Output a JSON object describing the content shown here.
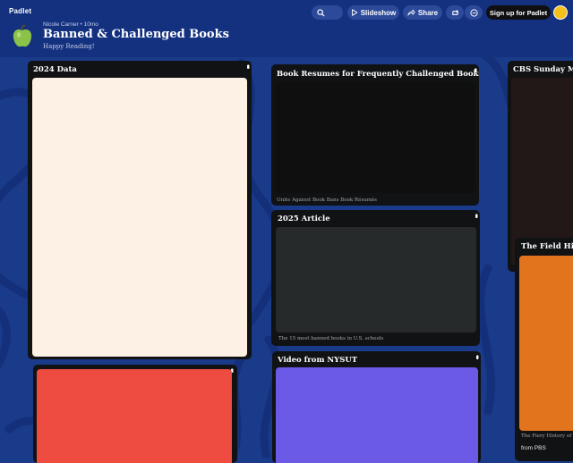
{
  "app": {
    "brand": "Padlet"
  },
  "header": {
    "author_meta": "Nicole Carner • 10mo",
    "title": "Banned & Challenged Books",
    "subtitle": "Happy Reading!"
  },
  "toolbar": {
    "slideshow_label": "Slideshow",
    "share_label": "Share",
    "signup_label": "Sign up for Padlet"
  },
  "colors": {
    "background": "#1a3a8a",
    "header": "#143180",
    "card": "#111214",
    "accent_green": "#8bc34a"
  },
  "cards": {
    "data_2024": {
      "title": "2024 Data",
      "media_color": "#fdf0e4"
    },
    "red_card": {
      "media_color": "#ee4c40"
    },
    "resumes": {
      "title": "Book Resumes for Frequently Challenged Books",
      "caption": "Unite Against Book Bans Book Résumés",
      "media_color": "#0f0f0f"
    },
    "article_2025": {
      "title": "2025 Article",
      "caption": "The 15 most banned books in U.S. schools",
      "media_color": "#262a2b"
    },
    "nysut": {
      "title": "Video from NYSUT",
      "media_color": "#6b5ae5"
    },
    "cbs": {
      "title": "CBS Sunday Mor",
      "media_color": "#221818"
    },
    "field": {
      "title": "The Field Histo",
      "caption": "The Fiery History of",
      "source": "from PBS",
      "media_color": "#e3741e"
    }
  }
}
